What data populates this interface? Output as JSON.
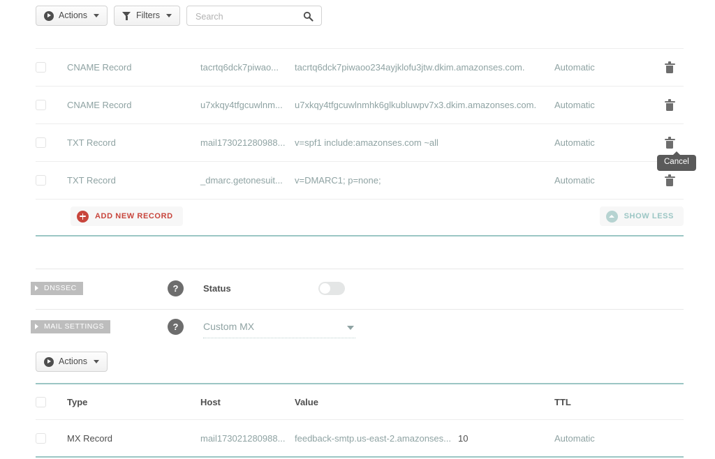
{
  "toolbar": {
    "actions_label": "Actions",
    "filters_label": "Filters",
    "search_placeholder": "Search",
    "search_value": ""
  },
  "records_table": {
    "rows": [
      {
        "type": "CNAME Record",
        "host": "tacrtq6dck7piwao...",
        "value": "tacrtq6dck7piwaoo234ayjklofu3jtw.dkim.amazonses.com.",
        "ttl": "Automatic"
      },
      {
        "type": "CNAME Record",
        "host": "u7xkqy4tfgcuwlnm...",
        "value": "u7xkqy4tfgcuwlnmhk6glkubluwpv7x3.dkim.amazonses.com.",
        "ttl": "Automatic"
      },
      {
        "type": "TXT Record",
        "host": "mail173021280988...",
        "value": "v=spf1 include:amazonses.com ~all",
        "ttl": "Automatic"
      },
      {
        "type": "TXT Record",
        "host": "_dmarc.getonesuit...",
        "value": "v=DMARC1; p=none;",
        "ttl": "Automatic"
      }
    ],
    "add_record_label": "ADD NEW RECORD",
    "show_less_label": "SHOW LESS"
  },
  "tooltip": {
    "text": "Cancel"
  },
  "dnssec": {
    "tag_label": "DNSSEC",
    "help_glyph": "?",
    "status_label": "Status",
    "status_on": false
  },
  "mail_settings": {
    "tag_label": "MAIL SETTINGS",
    "help_glyph": "?",
    "mx_mode": "Custom MX",
    "actions_label": "Actions"
  },
  "mx_table": {
    "columns": {
      "type": "Type",
      "host": "Host",
      "value": "Value",
      "ttl": "TTL"
    },
    "rows": [
      {
        "type": "MX Record",
        "host": "mail173021280988...",
        "value": "feedback-smtp.us-east-2.amazonses...",
        "priority": "10",
        "ttl": "Automatic"
      }
    ]
  },
  "colors": {
    "teal": "#9bc6c4",
    "teal_text": "#8fa3a3",
    "red": "#c8453c",
    "tag_gray": "#bdbdbd",
    "tooltip_bg": "#5a5a5a"
  }
}
